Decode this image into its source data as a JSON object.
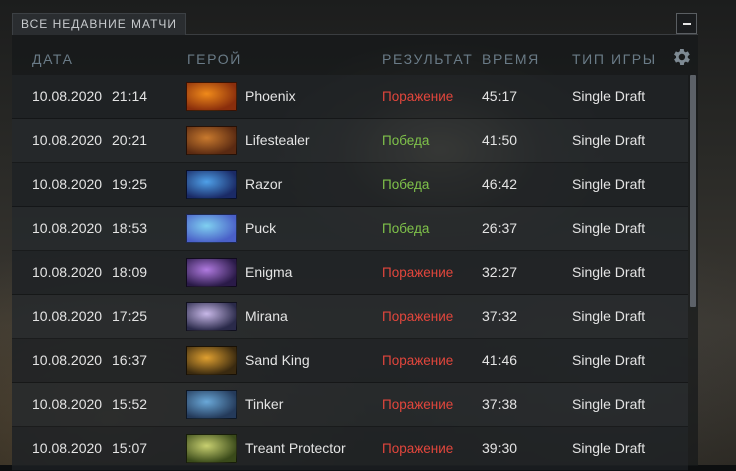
{
  "panel": {
    "title": "ВСЕ НЕДАВНИЕ МАТЧИ"
  },
  "columns": {
    "date": "ДАТА",
    "hero": "ГЕРОЙ",
    "result": "РЕЗУЛЬТАТ",
    "duration": "ВРЕМЯ",
    "game_type": "ТИП ИГРЫ"
  },
  "icons": {
    "minimize": "minimize-icon",
    "settings": "gear-icon"
  },
  "colors": {
    "loss": "#e2463c",
    "win": "#7fc24a",
    "header": "#6a7b87"
  },
  "matches": [
    {
      "date": "10.08.2020",
      "time": "21:14",
      "hero": "Phoenix",
      "result": "Поражение",
      "outcome": "loss",
      "duration": "45:17",
      "game_type": "Single Draft",
      "portrait": [
        "#f08a1a",
        "#8a2e0c"
      ]
    },
    {
      "date": "10.08.2020",
      "time": "20:21",
      "hero": "Lifestealer",
      "result": "Победа",
      "outcome": "win",
      "duration": "41:50",
      "game_type": "Single Draft",
      "portrait": [
        "#c97a2e",
        "#5a2a12"
      ]
    },
    {
      "date": "10.08.2020",
      "time": "19:25",
      "hero": "Razor",
      "result": "Победа",
      "outcome": "win",
      "duration": "46:42",
      "game_type": "Single Draft",
      "portrait": [
        "#4fa0e8",
        "#1a2a66"
      ]
    },
    {
      "date": "10.08.2020",
      "time": "18:53",
      "hero": "Puck",
      "result": "Победа",
      "outcome": "win",
      "duration": "26:37",
      "game_type": "Single Draft",
      "portrait": [
        "#7fd0f0",
        "#4a60c8"
      ]
    },
    {
      "date": "10.08.2020",
      "time": "18:09",
      "hero": "Enigma",
      "result": "Поражение",
      "outcome": "loss",
      "duration": "32:27",
      "game_type": "Single Draft",
      "portrait": [
        "#b07ae0",
        "#2a1a48"
      ]
    },
    {
      "date": "10.08.2020",
      "time": "17:25",
      "hero": "Mirana",
      "result": "Поражение",
      "outcome": "loss",
      "duration": "37:32",
      "game_type": "Single Draft",
      "portrait": [
        "#c8b8e8",
        "#2a2a4a"
      ]
    },
    {
      "date": "10.08.2020",
      "time": "16:37",
      "hero": "Sand King",
      "result": "Поражение",
      "outcome": "loss",
      "duration": "41:46",
      "game_type": "Single Draft",
      "portrait": [
        "#e0a030",
        "#3a2a10"
      ]
    },
    {
      "date": "10.08.2020",
      "time": "15:52",
      "hero": "Tinker",
      "result": "Поражение",
      "outcome": "loss",
      "duration": "37:38",
      "game_type": "Single Draft",
      "portrait": [
        "#6aa8d8",
        "#243a5a"
      ]
    },
    {
      "date": "10.08.2020",
      "time": "15:07",
      "hero": "Treant Protector",
      "result": "Поражение",
      "outcome": "loss",
      "duration": "39:30",
      "game_type": "Single Draft",
      "portrait": [
        "#c8d070",
        "#3a4a1a"
      ]
    }
  ]
}
